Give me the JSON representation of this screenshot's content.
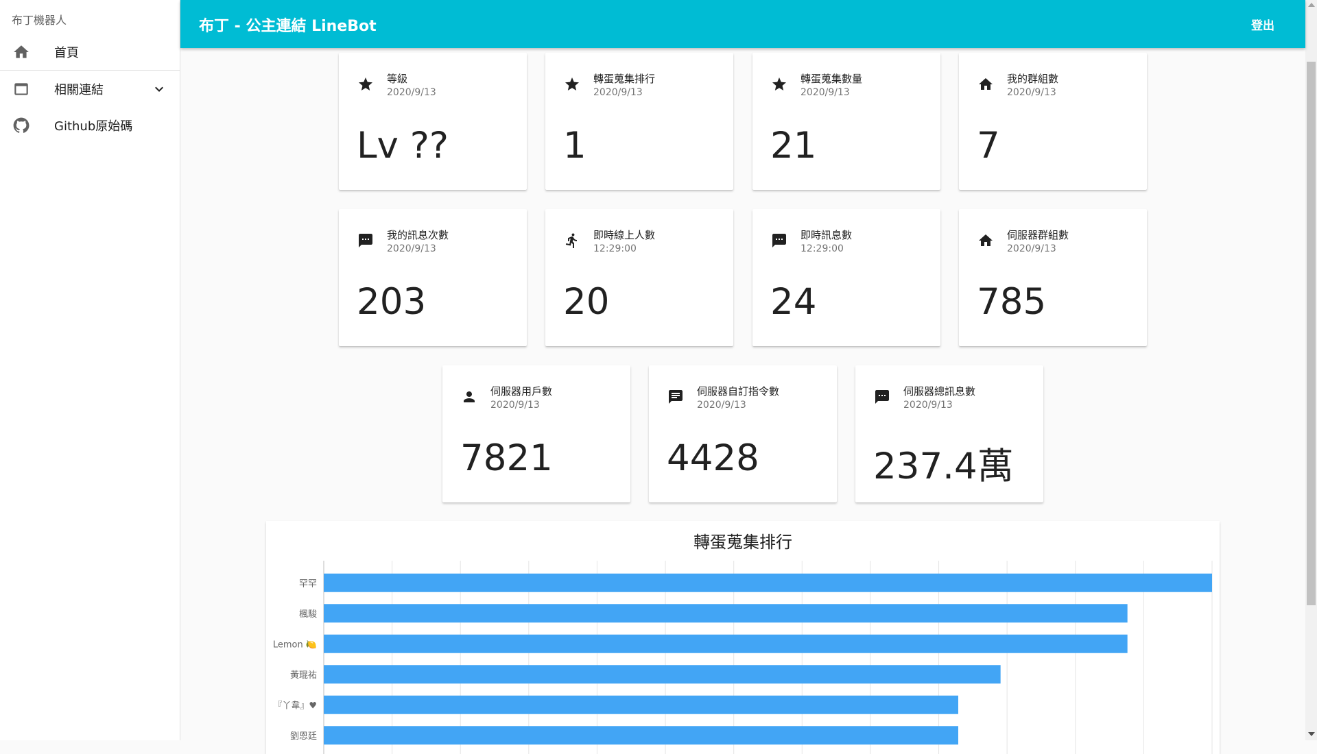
{
  "sidebar": {
    "title": "布丁機器人",
    "items": [
      {
        "label": "首頁",
        "icon": "home-icon"
      },
      {
        "label": "相關連結",
        "icon": "window-icon"
      },
      {
        "label": "Github原始碼",
        "icon": "github-icon"
      }
    ]
  },
  "header": {
    "title": "布丁 - 公主連結 LineBot",
    "logout": "登出",
    "color": "#00bcd4"
  },
  "cards": [
    {
      "title": "等級",
      "sub": "2020/9/13",
      "value": "Lv ??",
      "icon": "star-icon"
    },
    {
      "title": "轉蛋蒐集排行",
      "sub": "2020/9/13",
      "value": "1",
      "icon": "star-icon"
    },
    {
      "title": "轉蛋蒐集數量",
      "sub": "2020/9/13",
      "value": "21",
      "icon": "star-icon"
    },
    {
      "title": "我的群組數",
      "sub": "2020/9/13",
      "value": "7",
      "icon": "home-icon"
    },
    {
      "title": "我的訊息次數",
      "sub": "2020/9/13",
      "value": "203",
      "icon": "message-icon"
    },
    {
      "title": "即時線上人數",
      "sub": "12:29:00",
      "value": "20",
      "icon": "running-icon"
    },
    {
      "title": "即時訊息數",
      "sub": "12:29:00",
      "value": "24",
      "icon": "message-icon"
    },
    {
      "title": "伺服器群組數",
      "sub": "2020/9/13",
      "value": "785",
      "icon": "home-icon"
    },
    {
      "title": "伺服器用戶數",
      "sub": "2020/9/13",
      "value": "7821",
      "icon": "person-icon"
    },
    {
      "title": "伺服器自訂指令數",
      "sub": "2020/9/13",
      "value": "4428",
      "icon": "chat-icon"
    },
    {
      "title": "伺服器總訊息數",
      "sub": "2020/9/13",
      "value": "237.4萬",
      "icon": "message-icon"
    }
  ],
  "chart_data": {
    "type": "bar",
    "orientation": "horizontal",
    "title": "轉蛋蒐集排行",
    "categories": [
      "罕罕",
      "楓駿",
      "Lemon 🍋",
      "黃琨祐",
      "『丫韋』♥",
      "劉恩廷"
    ],
    "values": [
      21,
      19,
      19,
      16,
      15,
      15
    ],
    "xlim": [
      0,
      21
    ],
    "grid": true,
    "bar_color": "#42a5f5"
  }
}
